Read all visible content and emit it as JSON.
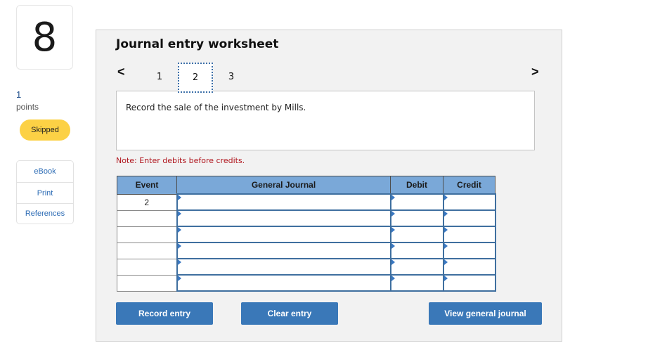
{
  "question": {
    "number": "8",
    "points_value": "1",
    "points_label": "points",
    "status": "Skipped"
  },
  "side_links": [
    "eBook",
    "Print",
    "References"
  ],
  "worksheet": {
    "title": "Journal entry worksheet",
    "nav_prev_icon": "chevron-left-icon",
    "nav_next_icon": "chevron-right-icon",
    "tabs": [
      "1",
      "2",
      "3"
    ],
    "active_tab": "2",
    "prompt": "Record the sale of the investment by Mills.",
    "note": "Note: Enter debits before credits.",
    "table": {
      "columns": [
        "Event",
        "General Journal",
        "Debit",
        "Credit"
      ],
      "rows": [
        {
          "event": "2",
          "general_journal": "",
          "debit": "",
          "credit": ""
        },
        {
          "event": "",
          "general_journal": "",
          "debit": "",
          "credit": ""
        },
        {
          "event": "",
          "general_journal": "",
          "debit": "",
          "credit": ""
        },
        {
          "event": "",
          "general_journal": "",
          "debit": "",
          "credit": ""
        },
        {
          "event": "",
          "general_journal": "",
          "debit": "",
          "credit": ""
        },
        {
          "event": "",
          "general_journal": "",
          "debit": "",
          "credit": ""
        }
      ]
    },
    "buttons": {
      "record": "Record entry",
      "clear": "Clear entry",
      "view": "View general journal"
    }
  }
}
